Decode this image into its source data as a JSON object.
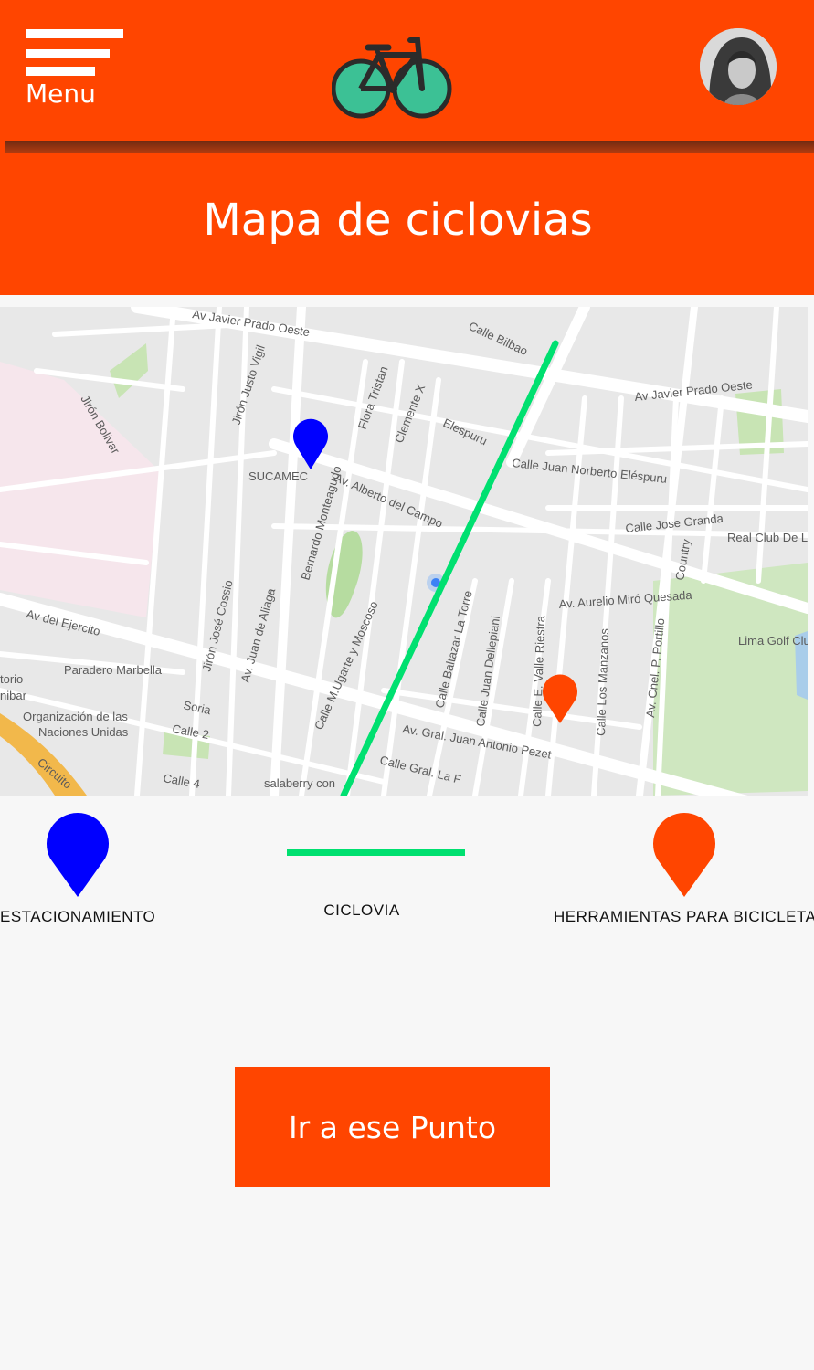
{
  "header": {
    "menu_label": "Menu",
    "logo_icon": "bicycle-icon",
    "avatar_icon": "user-avatar",
    "background": "#ff4500"
  },
  "page_title": "Mapa de ciclovias",
  "map": {
    "labels": [
      "Av Javier Prado Oeste",
      "Calle Bilbao",
      "Av Javier Prado Oeste",
      "Jirón Justo Vigil",
      "Flora Tristan",
      "Clemente X",
      "Elespuru",
      "Calle Juan Norberto Eléspuru",
      "SUCAMEC",
      "Av. Alberto del Campo",
      "Calle Jose Granda",
      "Real Club De Li",
      "Av. Aurelio Miró Quesada",
      "Lima Golf Clu",
      "Av del Ejercito",
      "Paradero Marbella",
      "Organización de las",
      "Naciones Unidas",
      "Av. Gral. Juan Antonio Pezet",
      "Calle Gral. La F",
      "salaberry con",
      "Calle 4",
      "Calle 2",
      "Soria",
      "Jirón Bolivar",
      "Bernardo Monteagudo",
      "Calle M.Ugarte y Moscoso",
      "Calle Baltazar La Torre",
      "Calle Juan Dellepiani",
      "Calle E. Valle Riestra",
      "Calle Los Manzanos",
      "Av. Cnel. P. Portillo",
      "Country",
      "Jirón José Cossio",
      "Av. Juan de Aliaga",
      "Circuito",
      "torio",
      "nibar"
    ],
    "route_color": "#00e070",
    "parking_color": "#0000ff",
    "tools_color": "#ff4500"
  },
  "legend": {
    "parking_label": "ESTACIONAMIENTO",
    "bikeway_label": "CICLOVIA",
    "tools_label": "HERRAMIENTAS PARA BICICLETAS"
  },
  "action": {
    "go_label": "Ir a ese Punto"
  }
}
